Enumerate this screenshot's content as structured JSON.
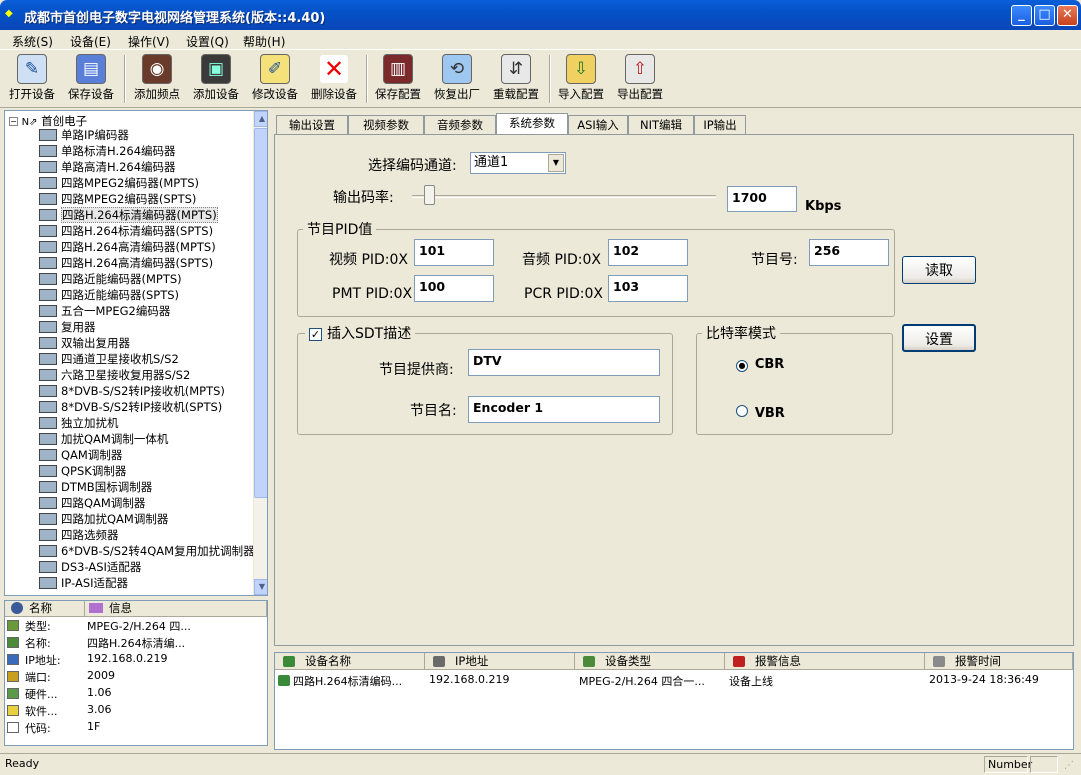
{
  "window": {
    "title": "成都市首创电子数字电视网络管理系统(版本::4.40)",
    "buttons": {
      "minimize": "_",
      "maximize": "□",
      "close": "✕"
    }
  },
  "menu": [
    "系统(S)",
    "设备(E)",
    "操作(V)",
    "设置(Q)",
    "帮助(H)"
  ],
  "toolbar": [
    {
      "label": "打开设备",
      "icon": "open-device-icon",
      "glyph": "✎"
    },
    {
      "label": "保存设备",
      "icon": "save-device-icon",
      "glyph": "▤"
    },
    {
      "label": "添加频点",
      "icon": "add-frequency-icon",
      "glyph": "◉"
    },
    {
      "label": "添加设备",
      "icon": "add-device-icon",
      "glyph": "▣"
    },
    {
      "label": "修改设备",
      "icon": "edit-device-icon",
      "glyph": "✐"
    },
    {
      "label": "删除设备",
      "icon": "delete-device-icon",
      "glyph": "✕"
    },
    {
      "label": "保存配置",
      "icon": "save-config-icon",
      "glyph": "▥"
    },
    {
      "label": "恢复出厂",
      "icon": "factory-reset-icon",
      "glyph": "⟲"
    },
    {
      "label": "重载配置",
      "icon": "reload-config-icon",
      "glyph": "⇵"
    },
    {
      "label": "导入配置",
      "icon": "import-config-icon",
      "glyph": "⇩"
    },
    {
      "label": "导出配置",
      "icon": "export-config-icon",
      "glyph": "⇧"
    }
  ],
  "tree": {
    "root": "首创电子",
    "items": [
      "单路IP编码器",
      "单路标清H.264编码器",
      "单路高清H.264编码器",
      "四路MPEG2编码器(MPTS)",
      "四路MPEG2编码器(SPTS)",
      "四路H.264标清编码器(MPTS)",
      "四路H.264标清编码器(SPTS)",
      "四路H.264高清编码器(MPTS)",
      "四路H.264高清编码器(SPTS)",
      "四路近能编码器(MPTS)",
      "四路近能编码器(SPTS)",
      "五合一MPEG2编码器",
      "复用器",
      "双输出复用器",
      "四通道卫星接收机S/S2",
      "六路卫星接收复用器S/S2",
      "8*DVB-S/S2转IP接收机(MPTS)",
      "8*DVB-S/S2转IP接收机(SPTS)",
      "独立加扰机",
      "加扰QAM调制一体机",
      "QAM调制器",
      "QPSK调制器",
      "DTMB国标调制器",
      "四路QAM调制器",
      "四路加扰QAM调制器",
      "四路选频器",
      "6*DVB-S/S2转4QAM复用加扰调制器",
      "DS3-ASI适配器",
      "IP-ASI适配器"
    ],
    "selected_index": 5
  },
  "info": {
    "headers": [
      "名称",
      "信息"
    ],
    "rows": [
      {
        "k": "类型:",
        "v": "MPEG-2/H.264 四..."
      },
      {
        "k": "名称:",
        "v": "四路H.264标清编..."
      },
      {
        "k": "IP地址:",
        "v": "192.168.0.219"
      },
      {
        "k": "端口:",
        "v": "2009"
      },
      {
        "k": "硬件...",
        "v": "1.06"
      },
      {
        "k": "软件...",
        "v": "3.06"
      },
      {
        "k": "代码:",
        "v": "1F"
      }
    ]
  },
  "tabs": [
    "输出设置",
    "视频参数",
    "音频参数",
    "系统参数",
    "ASI输入",
    "NIT编辑",
    "IP输出"
  ],
  "active_tab": 3,
  "form": {
    "channel_label": "选择编码通道:",
    "channel_value": "通道1",
    "bitrate_label": "输出码率:",
    "bitrate_value": "1700",
    "bitrate_unit": "Kbps",
    "bitrate_slider_fraction": 0.04,
    "pid_group": "节目PID值",
    "video_pid_label": "视频 PID:0X",
    "video_pid": "101",
    "audio_pid_label": "音频 PID:0X",
    "audio_pid": "102",
    "program_no_label": "节目号:",
    "program_no": "256",
    "pmt_pid_label": "PMT PID:0X",
    "pmt_pid": "100",
    "pcr_pid_label": "PCR PID:0X",
    "pcr_pid": "103",
    "read_button": "读取",
    "sdt_checkbox_label": "插入SDT描述",
    "sdt_checked": true,
    "provider_label": "节目提供商:",
    "provider_value": "DTV",
    "name_label": "节目名:",
    "name_value": "Encoder 1",
    "rate_group": "比特率模式",
    "cbr_label": "CBR",
    "vbr_label": "VBR",
    "selected_mode": "CBR",
    "set_button": "设置"
  },
  "device_list": {
    "headers": [
      "设备名称",
      "IP地址",
      "设备类型",
      "报警信息",
      "报警时间"
    ],
    "rows": [
      [
        "四路H.264标清编码...",
        "192.168.0.219",
        "MPEG-2/H.264 四合一...",
        "设备上线",
        "2013-9-24 18:36:49"
      ]
    ]
  },
  "status": {
    "left": "Ready",
    "right": "Number"
  }
}
